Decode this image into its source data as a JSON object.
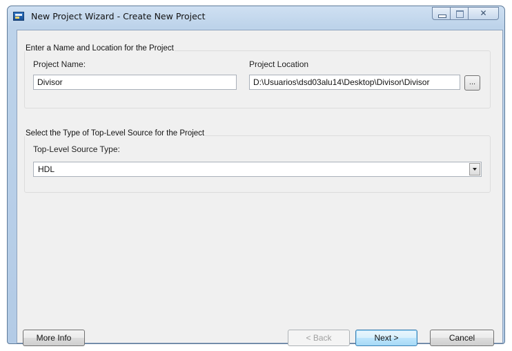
{
  "window": {
    "title": "New Project Wizard - Create New Project",
    "icon": "app-icon",
    "controls": {
      "minimize": "minimize-icon",
      "maximize": "maximize-icon",
      "close_glyph": "✕"
    }
  },
  "name_location_group": {
    "legend": "Enter a Name and Location for the Project",
    "project_name_label": "Project Name:",
    "project_name_value": "Divisor",
    "project_location_label": "Project Location",
    "project_location_value": "D:\\Usuarios\\dsd03alu14\\Desktop\\Divisor\\Divisor",
    "browse_label": "..."
  },
  "source_group": {
    "legend": "Select the Type of Top-Level Source for the Project",
    "type_label": "Top-Level Source Type:",
    "type_value": "HDL"
  },
  "footer": {
    "more_info": "More Info",
    "back": "< Back",
    "next": "Next >",
    "cancel": "Cancel"
  }
}
